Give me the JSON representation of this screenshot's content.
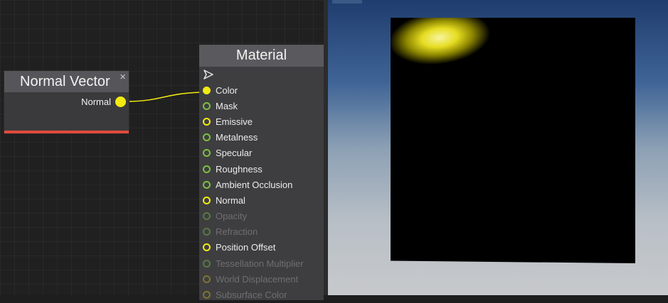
{
  "nodes": {
    "normal_vector": {
      "title": "Normal Vector",
      "close_glyph": "×",
      "output_label": "Normal",
      "pin_color": "#f2ea12",
      "accent_color": "#e14a3c"
    },
    "material": {
      "title": "Material",
      "exec_icon": "arrow-right-outline-icon",
      "inputs": [
        {
          "label": "Color",
          "pin": "filled",
          "color": "#f2ea12",
          "enabled": true
        },
        {
          "label": "Mask",
          "pin": "ring",
          "color": "#7fbf3f",
          "enabled": true
        },
        {
          "label": "Emissive",
          "pin": "ring",
          "color": "#f2ea12",
          "enabled": true
        },
        {
          "label": "Metalness",
          "pin": "ring",
          "color": "#7fbf3f",
          "enabled": true
        },
        {
          "label": "Specular",
          "pin": "ring",
          "color": "#7fbf3f",
          "enabled": true
        },
        {
          "label": "Roughness",
          "pin": "ring",
          "color": "#7fbf3f",
          "enabled": true
        },
        {
          "label": "Ambient Occlusion",
          "pin": "ring",
          "color": "#7fbf3f",
          "enabled": true
        },
        {
          "label": "Normal",
          "pin": "ring",
          "color": "#f2ea12",
          "enabled": true
        },
        {
          "label": "Opacity",
          "pin": "ring",
          "color": "#7fbf3f",
          "enabled": false
        },
        {
          "label": "Refraction",
          "pin": "ring",
          "color": "#7fbf3f",
          "enabled": false
        },
        {
          "label": "Position Offset",
          "pin": "ring",
          "color": "#f2ea12",
          "enabled": true
        },
        {
          "label": "Tessellation Multiplier",
          "pin": "ring",
          "color": "#7fbf3f",
          "enabled": false
        },
        {
          "label": "World Displacement",
          "pin": "ring",
          "color": "#c9b81a",
          "enabled": false
        },
        {
          "label": "Subsurface Color",
          "pin": "ring",
          "color": "#c9b81a",
          "enabled": false
        }
      ]
    }
  },
  "connection": {
    "from": "Normal Vector.Normal",
    "to": "Material.Color",
    "color": "#f2ea12"
  },
  "viewport": {
    "object_color": "#000000",
    "highlight_color": "#e6dd22"
  }
}
